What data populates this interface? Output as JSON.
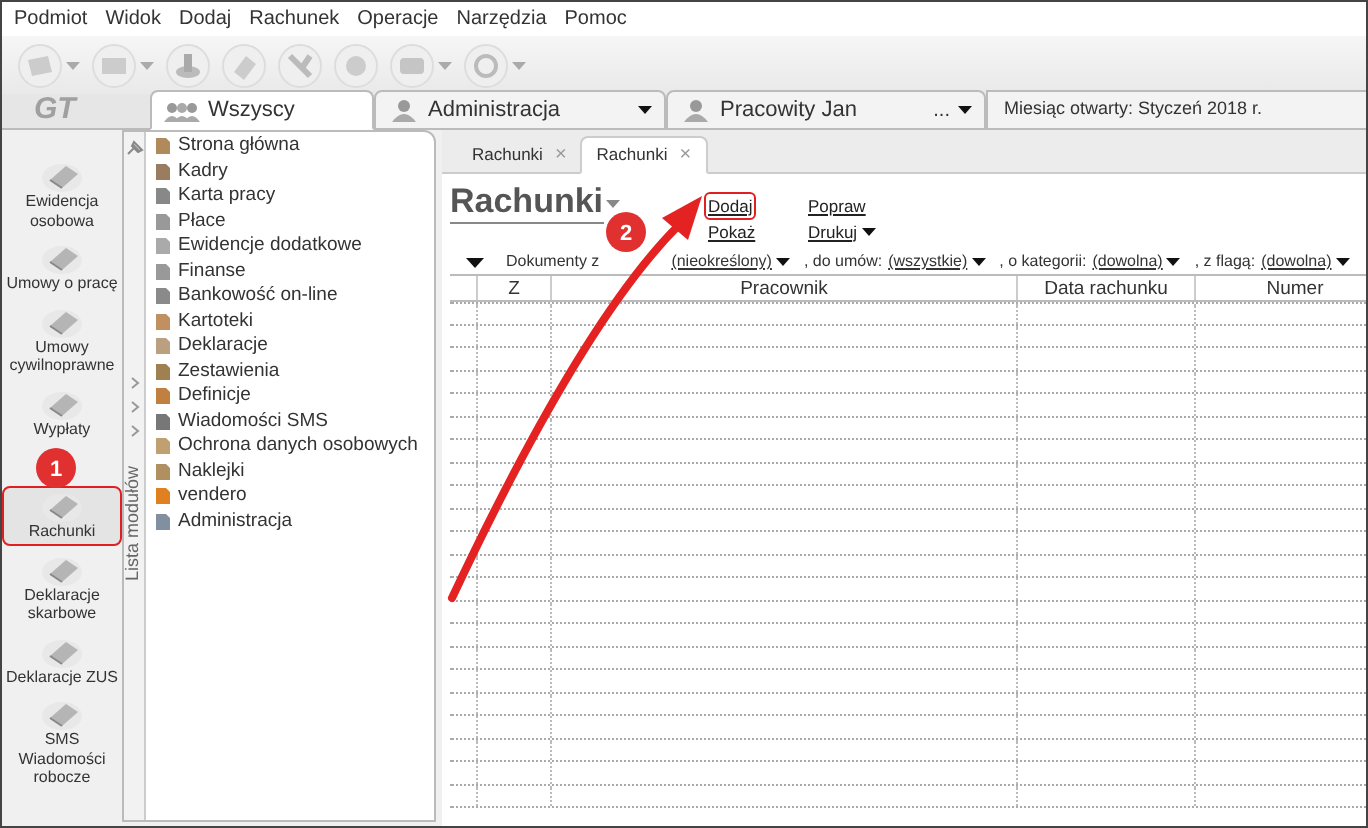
{
  "menu": [
    "Podmiot",
    "Widok",
    "Dodaj",
    "Rachunek",
    "Operacje",
    "Narzędzia",
    "Pomoc"
  ],
  "logo": "GT",
  "context_tabs": [
    {
      "label": "Wszyscy",
      "selected": true,
      "kind": "tab"
    },
    {
      "label": "Administracja",
      "selected": false,
      "kind": "dropdown"
    },
    {
      "label": "Pracowity Jan",
      "selected": false,
      "kind": "employee",
      "extra": "..."
    }
  ],
  "month": "Miesiąc otwarty: Styczeń 2018 r.",
  "modules": [
    {
      "label": "Ewidencja osobowa",
      "selected": false,
      "highlighted": false
    },
    {
      "label": "Umowy o pracę",
      "selected": false,
      "highlighted": false
    },
    {
      "label": "Umowy cywilnoprawne",
      "selected": false,
      "highlighted": false
    },
    {
      "label": "Wypłaty",
      "selected": false,
      "highlighted": false
    },
    {
      "label": "Rachunki",
      "selected": true,
      "highlighted": true
    },
    {
      "label": "Deklaracje skarbowe",
      "selected": false,
      "highlighted": false
    },
    {
      "label": "Deklaracje ZUS",
      "selected": false,
      "highlighted": false
    },
    {
      "label": "SMS Wiadomości robocze",
      "selected": false,
      "highlighted": false
    }
  ],
  "module_list": {
    "title": "Lista modułów",
    "items": [
      "Strona główna",
      "Kadry",
      "Karta pracy",
      "Płace",
      "Ewidencje dodatkowe",
      "Finanse",
      "Bankowość on-line",
      "Kartoteki",
      "Deklaracje",
      "Zestawienia",
      "Definicje",
      "Wiadomości SMS",
      "Ochrona danych osobowych",
      "Naklejki",
      "vendero",
      "Administracja"
    ]
  },
  "doc_tabs": [
    {
      "label": "Rachunki",
      "selected": false,
      "close": "×"
    },
    {
      "label": "Rachunki",
      "selected": true,
      "close": "×"
    }
  ],
  "page_title": "Rachunki",
  "actions": [
    {
      "label": "Dodaj",
      "kind": "link",
      "highlighted": true
    },
    {
      "label": "Pokaż",
      "kind": "link",
      "highlighted": false
    },
    {
      "label": "Popraw",
      "kind": "link",
      "highlighted": false
    },
    {
      "label": "Drukuj",
      "kind": "menu",
      "highlighted": false
    }
  ],
  "filters": [
    {
      "label": "Dokumenty z",
      "value": "(nieokreślony)"
    },
    {
      "label": ", do umów:",
      "value": "(wszystkie)"
    },
    {
      "label": ", o kategorii:",
      "value": "(dowolna)"
    },
    {
      "label": ", z flagą:",
      "value": "(dowolna)"
    }
  ],
  "table": {
    "columns": [
      "Z",
      "Pracownik",
      "Data rachunku",
      "Numer"
    ]
  },
  "annotations": [
    {
      "label": "1"
    },
    {
      "label": "2"
    }
  ]
}
